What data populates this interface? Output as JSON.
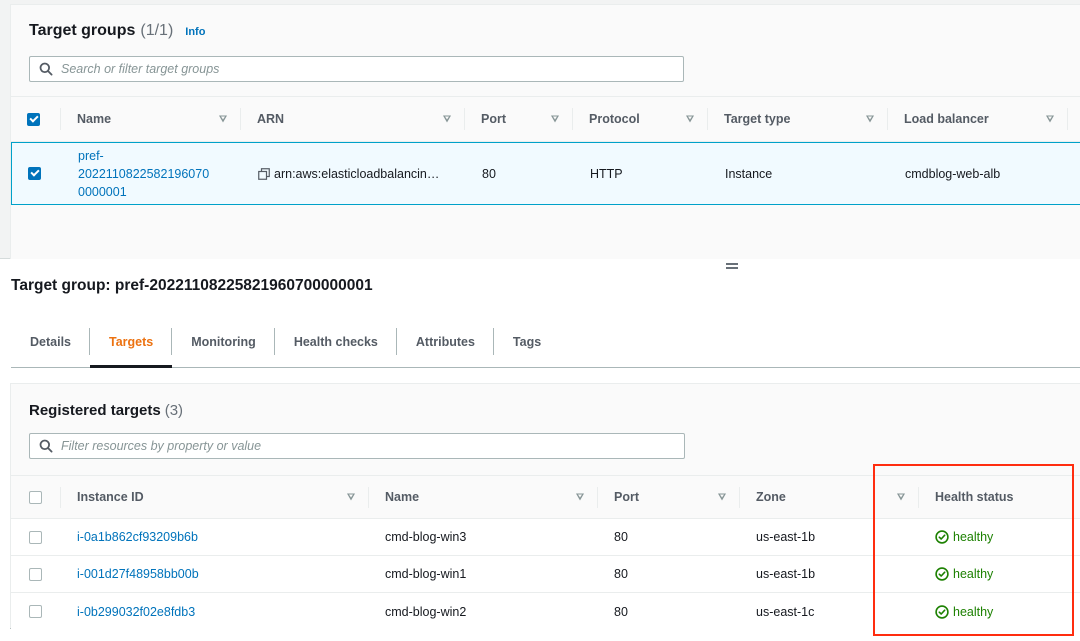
{
  "target_groups": {
    "title": "Target groups",
    "count": "(1/1)",
    "info_label": "Info",
    "search_placeholder": "Search or filter target groups",
    "columns": [
      "Name",
      "ARN",
      "Port",
      "Protocol",
      "Target type",
      "Load balancer"
    ],
    "rows": [
      {
        "selected": true,
        "name_lines": [
          "pref-",
          "202211082258219607",
          "0000001"
        ],
        "name_line1": "pref-",
        "name_line2": "20221108225821960 70",
        "arn": "arn:aws:elasticloadbalancin…",
        "port": "80",
        "protocol": "HTTP",
        "target_type": "Instance",
        "load_balancer": "cmdblog-web-alb"
      }
    ]
  },
  "detail": {
    "title": "Target group: pref-20221108225821960700000001",
    "tabs": [
      {
        "label": "Details",
        "active": false
      },
      {
        "label": "Targets",
        "active": true
      },
      {
        "label": "Monitoring",
        "active": false
      },
      {
        "label": "Health checks",
        "active": false
      },
      {
        "label": "Attributes",
        "active": false
      },
      {
        "label": "Tags",
        "active": false
      }
    ]
  },
  "registered_targets": {
    "title": "Registered targets",
    "count": "(3)",
    "search_placeholder": "Filter resources by property or value",
    "columns": [
      "Instance ID",
      "Name",
      "Port",
      "Zone",
      "Health status"
    ],
    "rows": [
      {
        "instance_id": "i-0a1b862cf93209b6b",
        "name": "cmd-blog-win3",
        "port": "80",
        "zone": "us-east-1b",
        "health": "healthy"
      },
      {
        "instance_id": "i-001d27f48958bb00b",
        "name": "cmd-blog-win1",
        "port": "80",
        "zone": "us-east-1b",
        "health": "healthy"
      },
      {
        "instance_id": "i-0b299032f02e8fdb3",
        "name": "cmd-blog-win2",
        "port": "80",
        "zone": "us-east-1c",
        "health": "healthy"
      }
    ]
  },
  "colors": {
    "link": "#0073bb",
    "active_tab": "#ec7211",
    "healthy": "#1d8102",
    "annotation": "#ff2d0f",
    "selected_row_bg": "#f1faff",
    "selected_row_border": "#00a1c9"
  }
}
